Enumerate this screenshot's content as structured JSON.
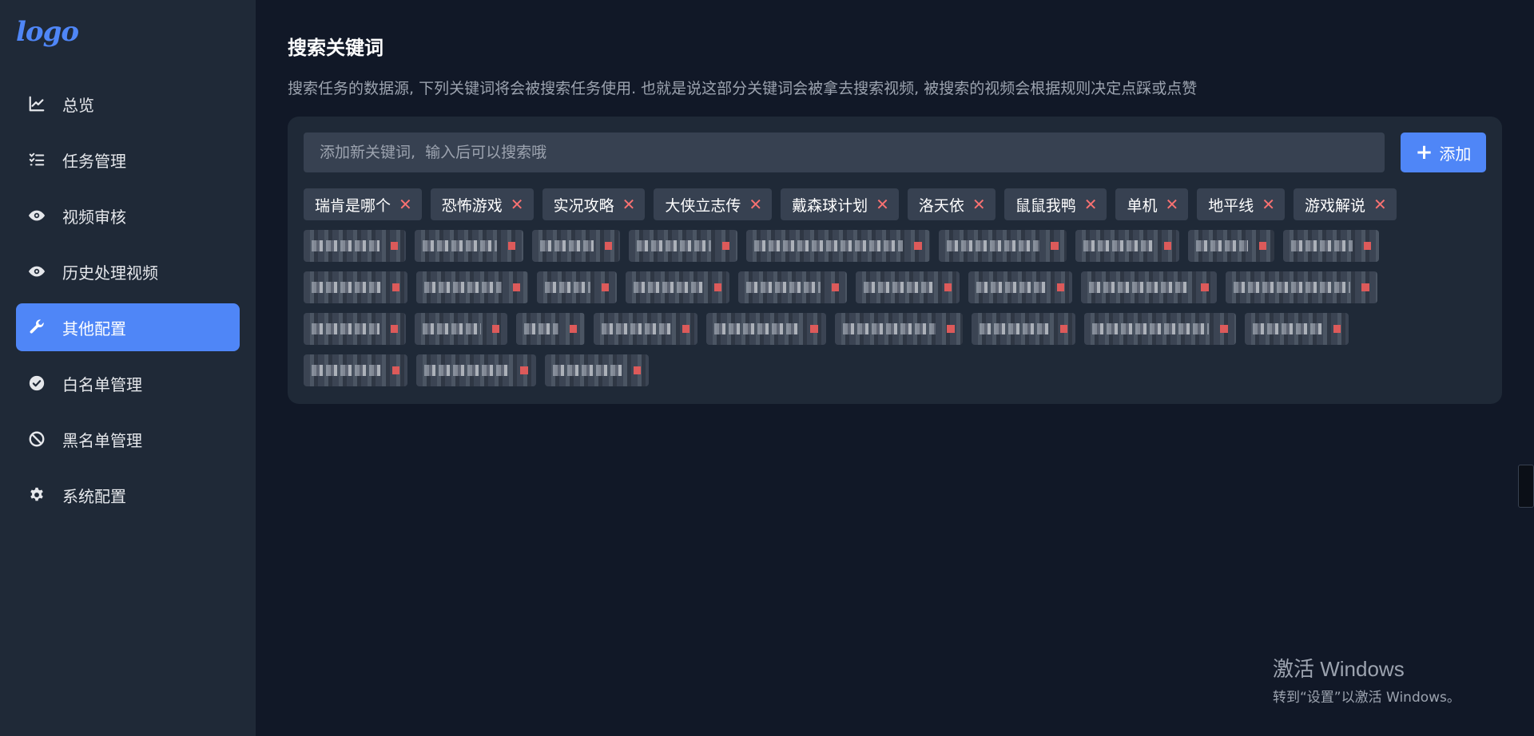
{
  "logo": {
    "text": "logo"
  },
  "sidebar": {
    "items": [
      {
        "label": "总览",
        "icon": "chart-line-icon",
        "active": false
      },
      {
        "label": "任务管理",
        "icon": "tasks-list-icon",
        "active": false
      },
      {
        "label": "视频审核",
        "icon": "eye-icon",
        "active": false
      },
      {
        "label": "历史处理视频",
        "icon": "eye-icon",
        "active": false
      },
      {
        "label": "其他配置",
        "icon": "wrench-icon",
        "active": true
      },
      {
        "label": "白名单管理",
        "icon": "check-circle-icon",
        "active": false
      },
      {
        "label": "黑名单管理",
        "icon": "ban-icon",
        "active": false
      },
      {
        "label": "系统配置",
        "icon": "gear-icon",
        "active": false
      }
    ]
  },
  "main": {
    "title": "搜索关键词",
    "description": "搜索任务的数据源, 下列关键词将会被搜索任务使用. 也就是说这部分关键词会被拿去搜索视频, 被搜索的视频会根据规则决定点踩或点赞",
    "input": {
      "placeholder": "添加新关键词,  输入后可以搜索哦",
      "value": ""
    },
    "add_button": {
      "label": "添加"
    },
    "tags": [
      "瑞肯是哪个",
      "恐怖游戏",
      "实况攻略",
      "大侠立志传",
      "戴森球计划",
      "洛天依",
      "鼠鼠我鸭",
      "单机",
      "地平线",
      "游戏解说"
    ]
  },
  "colors": {
    "accent": "#4f86f7",
    "remove": "#f87171",
    "sidebar_bg": "#1f2937",
    "page_bg": "#111827"
  },
  "watermark": {
    "title": "激活 Windows",
    "subtitle": "转到“设置”以激活 Windows。"
  }
}
